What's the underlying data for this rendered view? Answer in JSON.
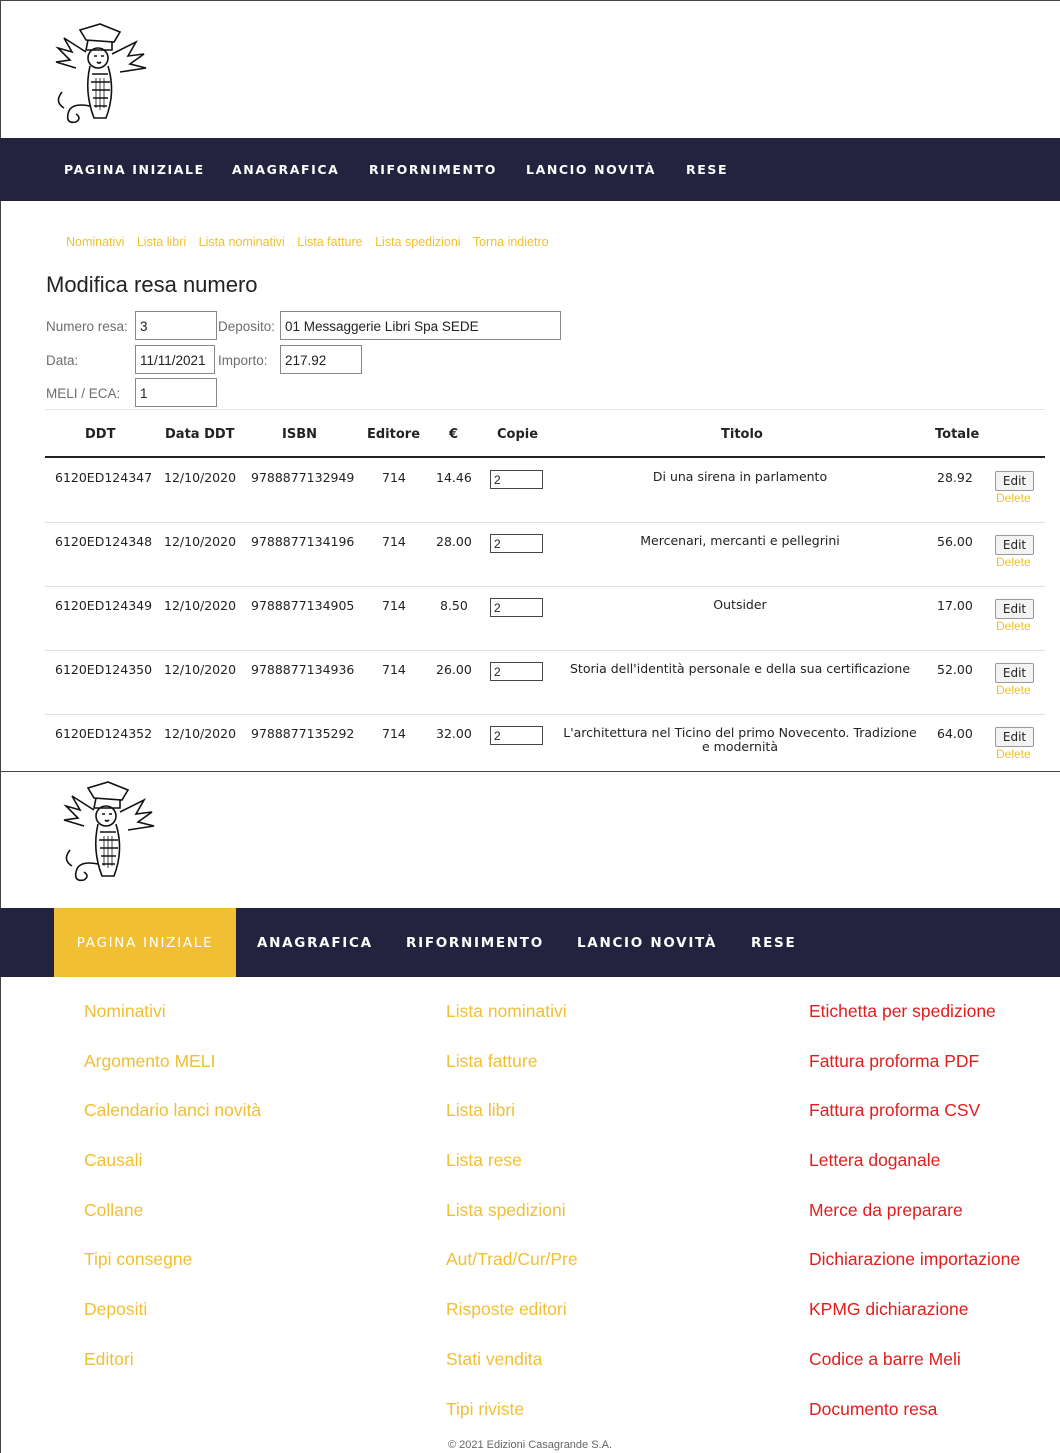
{
  "nav": [
    "PAGINA INIZIALE",
    "ANAGRAFICA",
    "RIFORNIMENTO",
    "LANCIO NOVITÀ",
    "RESE"
  ],
  "sublinks": [
    "Nominativi",
    "Lista libri",
    "Lista nominativi",
    "Lista fatture",
    "Lista spedizioni",
    "Torna indietro"
  ],
  "form": {
    "title": "Modifica resa numero",
    "numero_resa_label": "Numero resa:",
    "numero_resa_value": "3",
    "deposito_label": "Deposito:",
    "deposito_value": "01 Messaggerie Libri Spa SEDE",
    "data_label": "Data:",
    "data_value": "11/11/2021",
    "importo_label": "Importo:",
    "importo_value": "217.92",
    "meli_label": "MELI / ECA:",
    "meli_value": "1"
  },
  "table": {
    "headers": [
      "DDT",
      "Data DDT",
      "ISBN",
      "Editore",
      "€",
      "Copie",
      "Titolo",
      "Totale"
    ],
    "rows": [
      {
        "ddt": "6120ED124347",
        "data": "12/10/2020",
        "isbn": "9788877132949",
        "editore": "714",
        "prezzo": "14.46",
        "copie": "2",
        "titolo": "Di una sirena in parlamento",
        "totale": "28.92"
      },
      {
        "ddt": "6120ED124348",
        "data": "12/10/2020",
        "isbn": "9788877134196",
        "editore": "714",
        "prezzo": "28.00",
        "copie": "2",
        "titolo": "Mercenari, mercanti e pellegrini",
        "totale": "56.00"
      },
      {
        "ddt": "6120ED124349",
        "data": "12/10/2020",
        "isbn": "9788877134905",
        "editore": "714",
        "prezzo": "8.50",
        "copie": "2",
        "titolo": "Outsider",
        "totale": "17.00"
      },
      {
        "ddt": "6120ED124350",
        "data": "12/10/2020",
        "isbn": "9788877134936",
        "editore": "714",
        "prezzo": "26.00",
        "copie": "2",
        "titolo": "Storia dell'identità personale e della sua certificazione",
        "totale": "52.00"
      },
      {
        "ddt": "6120ED124352",
        "data": "12/10/2020",
        "isbn": "9788877135292",
        "editore": "714",
        "prezzo": "32.00",
        "copie": "2",
        "titolo": "L'architettura nel Ticino del primo Novecento. Tradizione e modernità",
        "totale": "64.00"
      }
    ],
    "edit_label": "Edit",
    "delete_label": "Delete"
  },
  "home_menu": {
    "col1": [
      "Nominativi",
      "Argomento MELI",
      "Calendario lanci novità",
      "Causali",
      "Collane",
      "Tipi consegne",
      "Depositi",
      "Editori"
    ],
    "col2": [
      "Lista nominativi",
      "Lista fatture",
      "Lista libri",
      "Lista rese",
      "Lista spedizioni",
      "Aut/Trad/Cur/Pre",
      "Risposte editori",
      "Stati vendita",
      "Tipi riviste"
    ],
    "col3": [
      "Etichetta per spedizione",
      "Fattura proforma PDF",
      "Fattura proforma CSV",
      "Lettera doganale",
      "Merce da preparare",
      "Dichiarazione importazione",
      "KPMG dichiarazione",
      "Codice a barre Meli",
      "Documento resa"
    ]
  },
  "footer": "© 2021 Edizioni Casagrande S.A.",
  "colors": {
    "navbar": "#23233f",
    "accent_yellow": "#f0bf33",
    "link_red": "#e21d1d"
  },
  "icons": {
    "logo": "bird-logo"
  }
}
